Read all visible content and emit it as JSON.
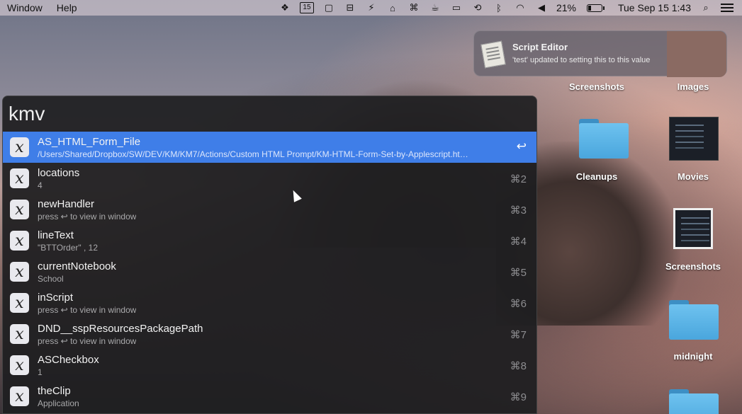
{
  "menubar": {
    "menus": [
      "Window",
      "Help"
    ],
    "status_icons": [
      "dropbox-icon",
      "calendar-icon",
      "window-icon",
      "control-icon",
      "bolt-icon",
      "keyboard-maestro-icon",
      "command-icon",
      "cup-icon",
      "airplay-icon",
      "time-machine-icon",
      "bluetooth-icon",
      "wifi-icon",
      "volume-icon"
    ],
    "calendar_day": "15",
    "battery_percent": "21%",
    "battery_level": 0.21,
    "datetime": "Tue Sep 15  1:43"
  },
  "notification": {
    "title": "Script Editor",
    "body": "'test' updated to setting this to this value"
  },
  "desktop": {
    "labels": [
      "Screenshots",
      "Images",
      "Cleanups",
      "Movies",
      "Screenshots",
      "midnight"
    ]
  },
  "launcher": {
    "query": "kmv",
    "icon_glyph": "𝑥",
    "results": [
      {
        "title": "AS_HTML_Form_File",
        "subtitle": "/Users/Shared/Dropbox/SW/DEV/KM/KM7/Actions/Custom HTML Prompt/KM-HTML-Form-Set-by-Applescript.ht…",
        "shortcut": "↩"
      },
      {
        "title": "locations",
        "subtitle": "4",
        "shortcut": "⌘2"
      },
      {
        "title": "newHandler",
        "subtitle": "press ↩ to view in window",
        "shortcut": "⌘3"
      },
      {
        "title": "lineText",
        "subtitle": "\"BTTOrder\" , 12",
        "shortcut": "⌘4"
      },
      {
        "title": "currentNotebook",
        "subtitle": "School",
        "shortcut": "⌘5"
      },
      {
        "title": "inScript",
        "subtitle": "press ↩ to view in window",
        "shortcut": "⌘6"
      },
      {
        "title": "DND__sspResourcesPackagePath",
        "subtitle": "press ↩ to view in window",
        "shortcut": "⌘7"
      },
      {
        "title": "ASCheckbox",
        "subtitle": "1",
        "shortcut": "⌘8"
      },
      {
        "title": "theClip",
        "subtitle": "Application",
        "shortcut": "⌘9"
      }
    ]
  },
  "colors": {
    "selection": "#3f7ee8",
    "panel": "#1e1e20"
  }
}
